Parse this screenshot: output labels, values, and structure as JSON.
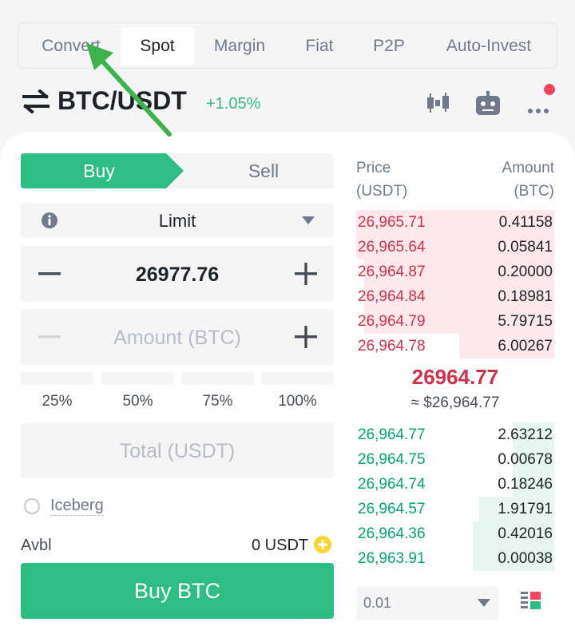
{
  "tabs": [
    {
      "label": "Convert"
    },
    {
      "label": "Spot"
    },
    {
      "label": "Margin"
    },
    {
      "label": "Fiat"
    },
    {
      "label": "P2P"
    },
    {
      "label": "Auto-Invest"
    }
  ],
  "pair": {
    "name": "BTC/USDT",
    "change": "+1.05%"
  },
  "order": {
    "buy_label": "Buy",
    "sell_label": "Sell",
    "type": "Limit",
    "price": "26977.76",
    "amount_placeholder": "Amount (BTC)",
    "percents": [
      "25%",
      "50%",
      "75%",
      "100%"
    ],
    "total_placeholder": "Total (USDT)",
    "iceberg_label": "Iceberg",
    "avbl_label": "Avbl",
    "avbl_value": "0 USDT",
    "submit_label": "Buy BTC"
  },
  "orderbook": {
    "price_header": [
      "Price",
      "(USDT)"
    ],
    "amount_header": [
      "Amount",
      "(BTC)"
    ],
    "asks": [
      {
        "price": "26,965.71",
        "amount": "0.41158",
        "depth": 1.0
      },
      {
        "price": "26,965.64",
        "amount": "0.05841",
        "depth": 1.0
      },
      {
        "price": "26,964.87",
        "amount": "0.20000",
        "depth": 0.96
      },
      {
        "price": "26,964.84",
        "amount": "0.18981",
        "depth": 0.96
      },
      {
        "price": "26,964.79",
        "amount": "5.79715",
        "depth": 0.96
      },
      {
        "price": "26,964.78",
        "amount": "6.00267",
        "depth": 0.48
      }
    ],
    "last_price": "26964.77",
    "last_price_usd": "≈ $26,964.77",
    "bids": [
      {
        "price": "26,964.77",
        "amount": "2.63212",
        "depth": 0.21
      },
      {
        "price": "26,964.75",
        "amount": "0.00678",
        "depth": 0.21
      },
      {
        "price": "26,964.74",
        "amount": "0.18246",
        "depth": 0.21
      },
      {
        "price": "26,964.57",
        "amount": "1.91791",
        "depth": 0.38
      },
      {
        "price": "26,964.36",
        "amount": "0.42016",
        "depth": 0.41
      },
      {
        "price": "26,963.91",
        "amount": "0.00038",
        "depth": 0.41
      }
    ],
    "precision": "0.01"
  },
  "colors": {
    "buy": "#2ebd85",
    "sell": "#f6465d",
    "ask_bg": "#fde9eb",
    "bid_bg": "#e7f7ef",
    "annotation_arrow": "#3cb44b"
  },
  "icons": [
    "swap-icon",
    "candlestick-chart-icon",
    "bot-icon",
    "more-icon",
    "info-icon",
    "chevron-down-icon",
    "minus-icon",
    "plus-icon",
    "add-circle-icon",
    "orderbook-view-icon"
  ]
}
